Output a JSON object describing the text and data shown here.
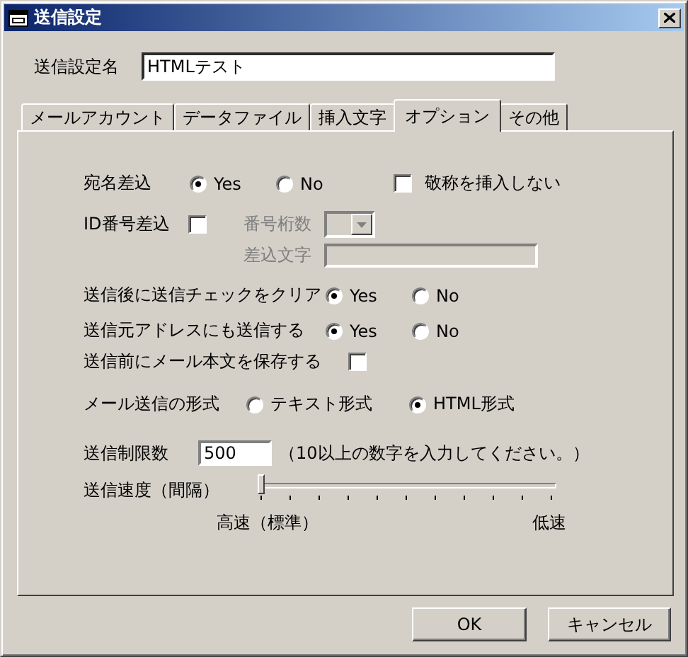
{
  "window": {
    "title": "送信設定"
  },
  "name_field": {
    "label": "送信設定名",
    "value": "HTMLテスト"
  },
  "tabs": [
    {
      "label": "メールアカウント",
      "selected": false
    },
    {
      "label": "データファイル",
      "selected": false
    },
    {
      "label": "挿入文字",
      "selected": false
    },
    {
      "label": "オプション",
      "selected": true
    },
    {
      "label": "その他",
      "selected": false
    }
  ],
  "address_insert": {
    "label": "宛名差込",
    "options": [
      {
        "label": "Yes",
        "selected": true
      },
      {
        "label": "No",
        "selected": false
      }
    ],
    "honorific": {
      "label": "敬称を挿入しない",
      "checked": false
    }
  },
  "id_insert": {
    "label": "ID番号差込",
    "checked": false,
    "digits": {
      "label": "番号桁数",
      "disabled": true
    },
    "insert_text": {
      "label": "差込文字",
      "disabled": true
    }
  },
  "clear_check": {
    "label": "送信後に送信チェックをクリア",
    "options": [
      {
        "label": "Yes",
        "selected": true
      },
      {
        "label": "No",
        "selected": false
      }
    ]
  },
  "send_to_sender": {
    "label": "送信元アドレスにも送信する",
    "options": [
      {
        "label": "Yes",
        "selected": true
      },
      {
        "label": "No",
        "selected": false
      }
    ]
  },
  "save_body": {
    "label": "送信前にメール本文を保存する",
    "checked": false
  },
  "mail_format": {
    "label": "メール送信の形式",
    "options": [
      {
        "label": "テキスト形式",
        "selected": false
      },
      {
        "label": "HTML形式",
        "selected": true
      }
    ]
  },
  "send_limit": {
    "label": "送信制限数",
    "value": "500",
    "hint": "（10以上の数字を入力してください。）"
  },
  "send_speed": {
    "label": "送信速度（間隔）",
    "level": 0,
    "min_label": "高速（標準）",
    "max_label": "低速"
  },
  "buttons": [
    "OK",
    "キャンセル"
  ]
}
